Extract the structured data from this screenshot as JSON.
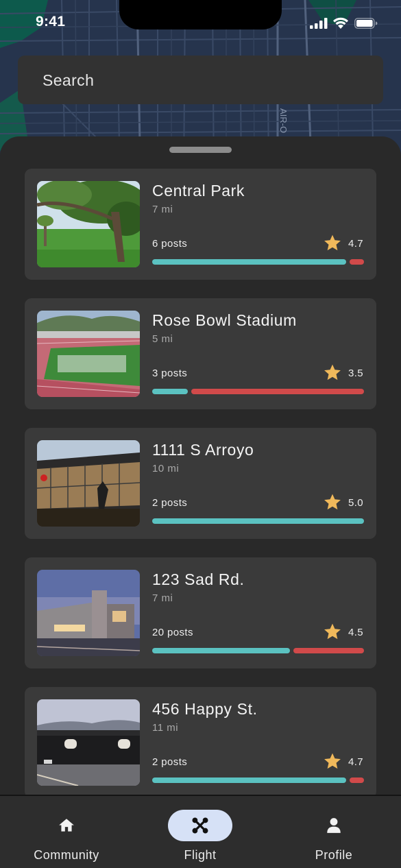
{
  "status_bar": {
    "time": "9:41"
  },
  "search": {
    "placeholder": "Search"
  },
  "map": {
    "street_label": "AIR-O"
  },
  "places": [
    {
      "name": "Central Park",
      "distance": "7 mi",
      "posts": "6 posts",
      "rating": "4.7",
      "positive_fraction": 0.93,
      "image": "park-photo"
    },
    {
      "name": "Rose Bowl Stadium",
      "distance": "5 mi",
      "posts": "3 posts",
      "rating": "3.5",
      "positive_fraction": 0.17,
      "image": "stadium-photo"
    },
    {
      "name": "1111 S Arroyo",
      "distance": "10 mi",
      "posts": "2 posts",
      "rating": "5.0",
      "positive_fraction": 1.0,
      "image": "glass-building-photo"
    },
    {
      "name": "123 Sad Rd.",
      "distance": "7 mi",
      "posts": "20 posts",
      "rating": "4.5",
      "positive_fraction": 0.66,
      "image": "modern-building-photo"
    },
    {
      "name": "456 Happy St.",
      "distance": "11 mi",
      "posts": "2 posts",
      "rating": "4.7",
      "positive_fraction": 0.93,
      "image": "black-building-photo"
    }
  ],
  "nav": [
    {
      "label": "Community",
      "icon": "home-icon",
      "active": false
    },
    {
      "label": "Flight",
      "icon": "drone-icon",
      "active": true
    },
    {
      "label": "Profile",
      "icon": "person-icon",
      "active": false
    }
  ],
  "colors": {
    "positive": "#5bc2c1",
    "negative": "#d14a4a",
    "star": "#f0b95b",
    "nav_active": "#d6e1f6"
  }
}
